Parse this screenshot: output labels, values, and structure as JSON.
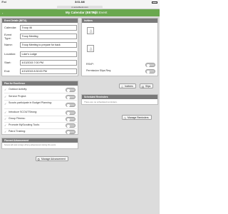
{
  "status": {
    "carrier": "iPad",
    "time": "8:01 AM"
  },
  "browser": {
    "url": "m.scoutbook.com"
  },
  "header": {
    "back_label": "‹",
    "calendar_title": "My Calendar (BETA)",
    "page_title": "Edit Event"
  },
  "event_details": {
    "title": "Event Details (BETA)",
    "fields": [
      {
        "label": "Calendar:",
        "value": "Troop 46"
      },
      {
        "label": "Event Type:",
        "value": "Troop Meeting"
      },
      {
        "label": "Name:",
        "value": "Troop Meeting to prepare for back"
      },
      {
        "label": "Location:",
        "value": "Luke's Lodge"
      },
      {
        "label": "Start:",
        "value": "4/13/2015 7:00 PM"
      },
      {
        "label": "End:",
        "value": "4/13/2015 8:30:00 PM"
      }
    ]
  },
  "invitees": {
    "title": "Invitees",
    "rsvp_label": "RSVP:",
    "permission_label": "Permission Slips Req:",
    "invitees_button": "Invitees",
    "slips_button": "Slips"
  },
  "plan": {
    "title": "Plan for Excellence",
    "items": [
      "Outdoor Activity:",
      "Service Project:",
      "Scouts participate in Budget Planning:",
      "Introduce SCOUTStrong:",
      "Group Fitness:",
      "Promote MyScouting Tools:",
      "Patrol Training:"
    ]
  },
  "reminders": {
    "title": "Scheduled Reminders",
    "empty_text": "There are no scheduled reminders.",
    "manage_button": "Manage Reminders"
  },
  "advancement": {
    "title": "Planned Advancement",
    "empty_text": "Scouts will work on/sign off any advancement during this event.",
    "manage_button": "Manage Advancement"
  },
  "colors": {
    "header": "#6aa84f",
    "panel_header": "#7a7a7a",
    "background": "#dcdcdc"
  }
}
